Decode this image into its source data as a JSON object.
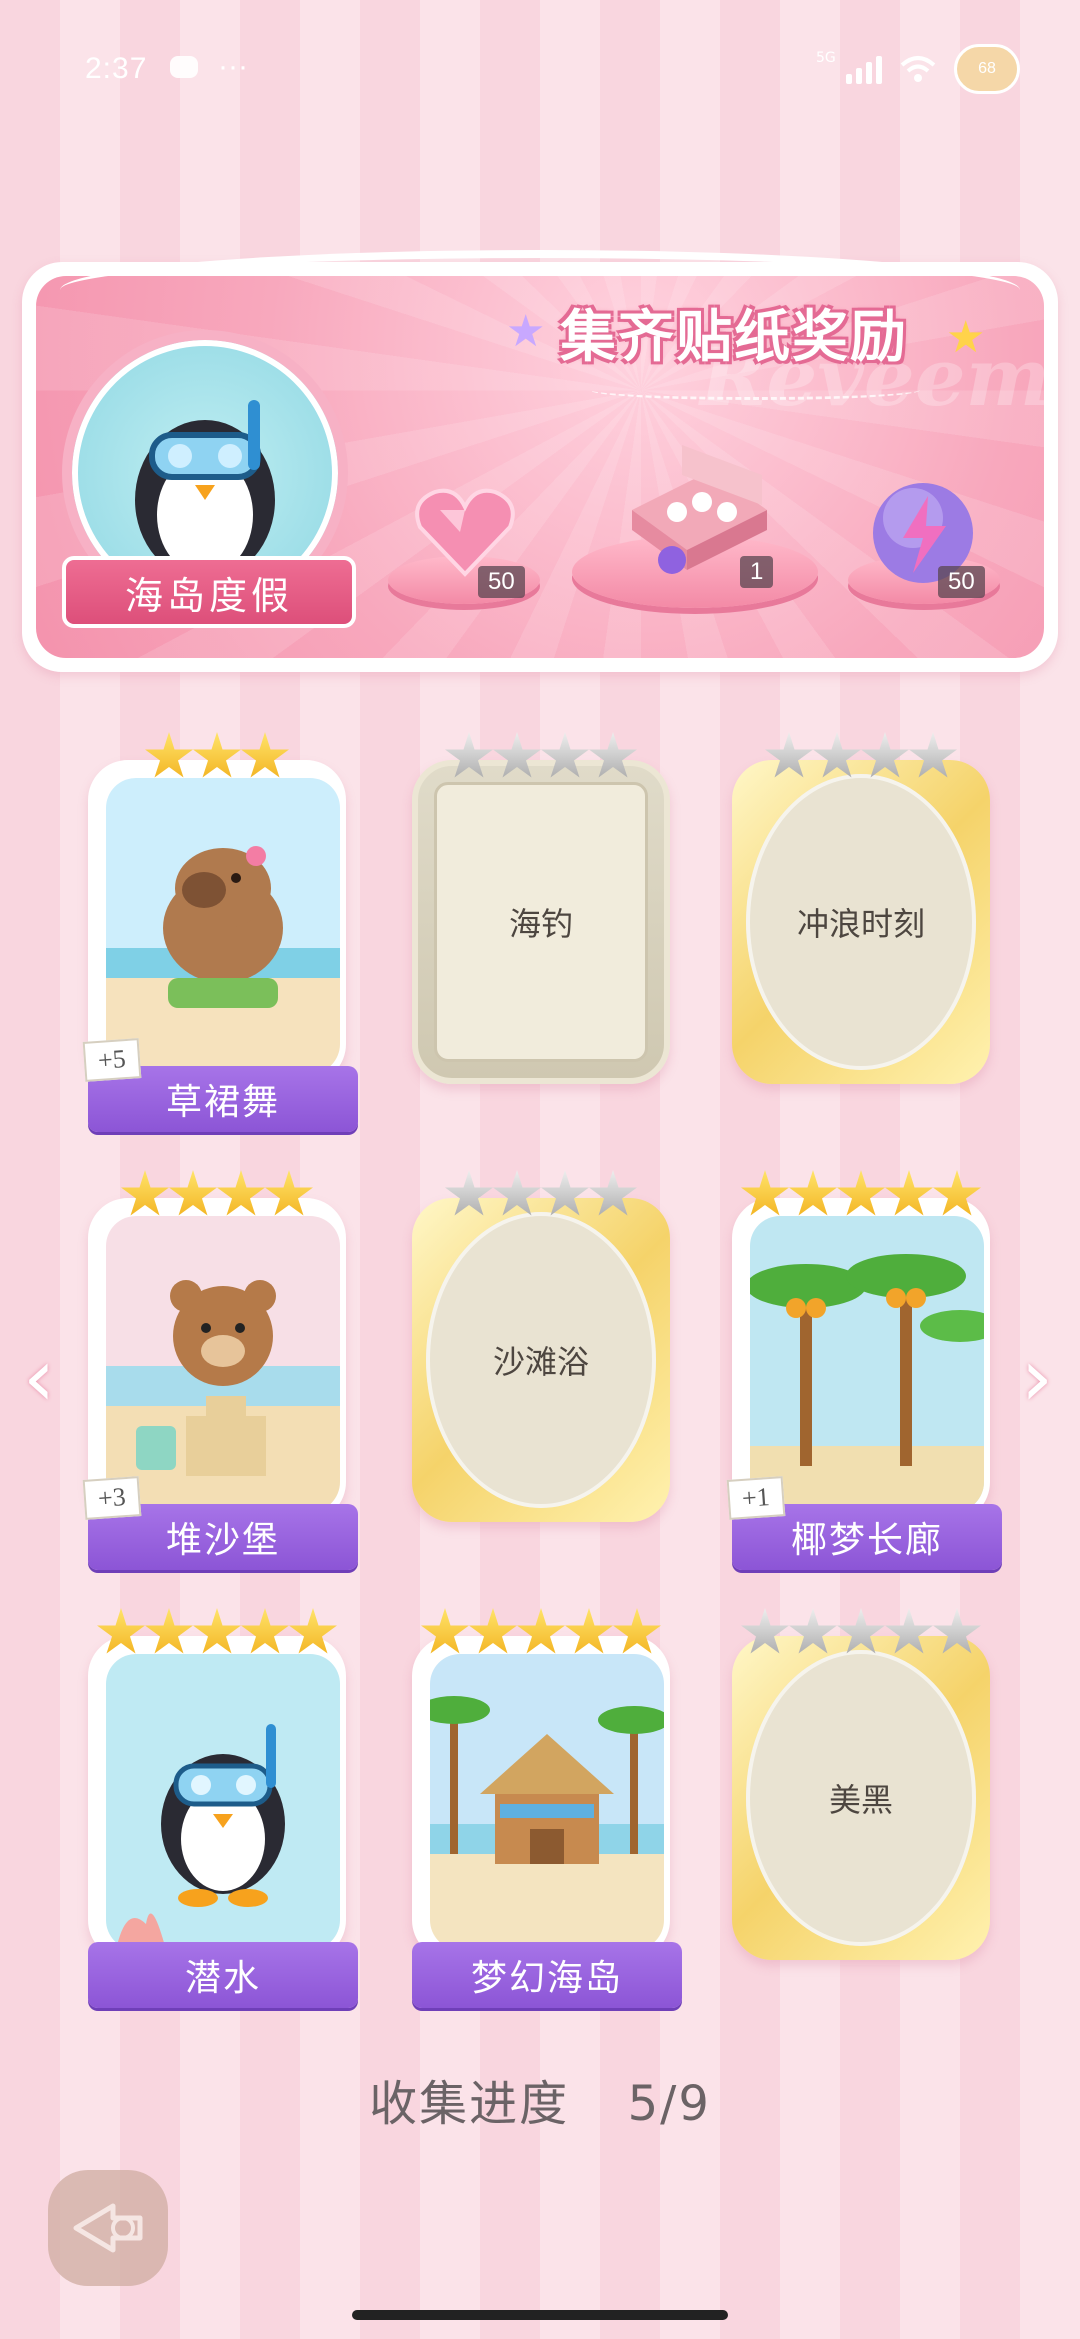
{
  "status_bar": {
    "time": "2:37",
    "dots": "···",
    "network": "5G",
    "avatar_badge": "68"
  },
  "banner": {
    "title": "集齐贴纸奖励",
    "watermark": "Reveem",
    "medal_label": "海岛度假",
    "rewards": [
      {
        "icon": "heart-gem-icon",
        "count": "50"
      },
      {
        "icon": "gift-box-icon",
        "count": "1"
      },
      {
        "icon": "energy-orb-icon",
        "count": "50"
      }
    ]
  },
  "cards": [
    {
      "name": "草裙舞",
      "stars_total": 3,
      "stars_earned": 3,
      "collected": true,
      "plus": "+5",
      "art": "capybara-hula-art"
    },
    {
      "name": "海钓",
      "stars_total": 4,
      "stars_earned": 0,
      "collected": false,
      "frame": "plain"
    },
    {
      "name": "冲浪时刻",
      "stars_total": 4,
      "stars_earned": 0,
      "collected": false
    },
    {
      "name": "堆沙堡",
      "stars_total": 4,
      "stars_earned": 4,
      "collected": true,
      "plus": "+3",
      "art": "bear-sandcastle-art"
    },
    {
      "name": "沙滩浴",
      "stars_total": 4,
      "stars_earned": 0,
      "collected": false
    },
    {
      "name": "椰梦长廊",
      "stars_total": 5,
      "stars_earned": 5,
      "collected": true,
      "plus": "+1",
      "art": "coconut-palms-art"
    },
    {
      "name": "潜水",
      "stars_total": 5,
      "stars_earned": 5,
      "collected": true,
      "art": "penguin-diving-art"
    },
    {
      "name": "梦幻海岛",
      "stars_total": 5,
      "stars_earned": 5,
      "collected": true,
      "art": "beach-hut-art"
    },
    {
      "name": "美黑",
      "stars_total": 5,
      "stars_earned": 0,
      "collected": false
    }
  ],
  "nav": {
    "prev": "‹",
    "next": "›"
  },
  "progress": {
    "label": "收集进度",
    "value": "5/9"
  },
  "colors": {
    "label_purple": "#9a63df",
    "gold": "#f5d36a",
    "pink": "#f8a8bd"
  }
}
